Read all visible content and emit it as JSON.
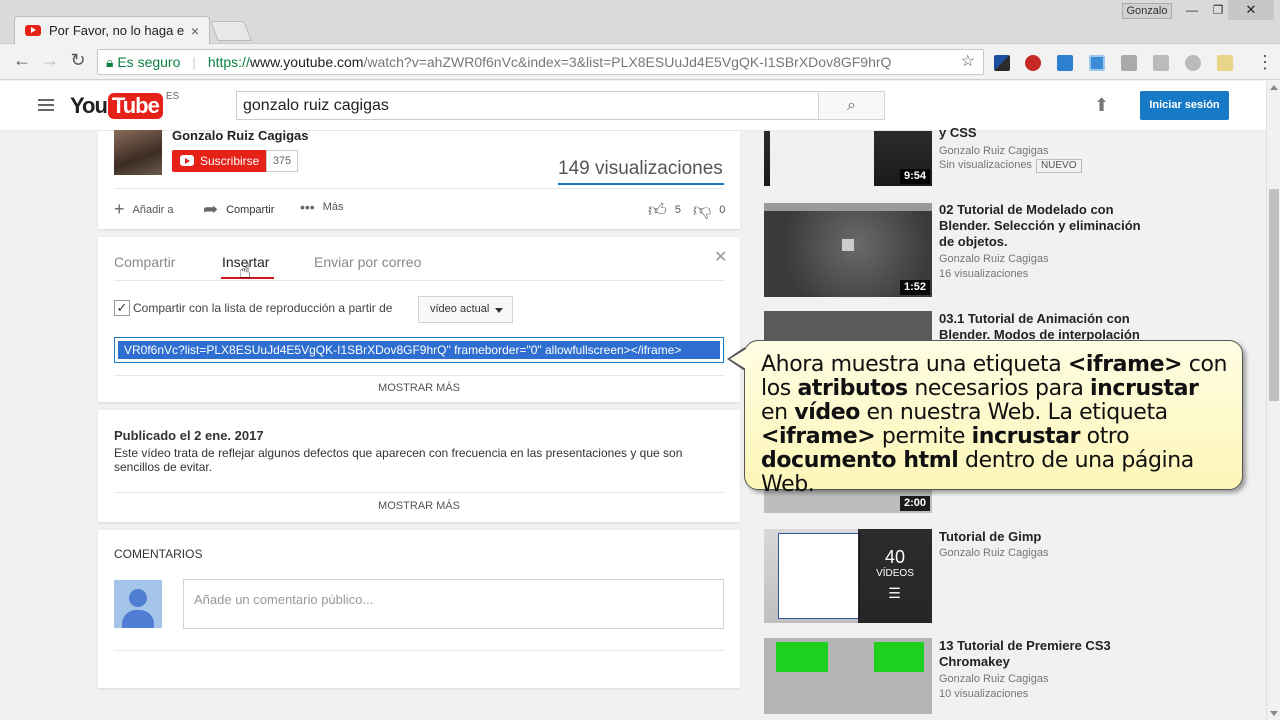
{
  "browser": {
    "tab_title": "Por Favor, no lo haga en",
    "tab_close": "×",
    "user_chip": "Gonzalo",
    "window_min": "—",
    "window_max": "❐",
    "window_close": "✕",
    "secure_label": "Es seguro",
    "url_scheme": "https://",
    "url_host": "www.youtube.com",
    "url_path": "/watch?v=ahZWR0f6nVc&index=3&list=PLX8ESUuJd4E5VgQK-I1SBrXDov8GF9hrQ"
  },
  "youtube": {
    "logo_you": "You",
    "logo_tube": "Tube",
    "logo_region": "ES",
    "search_value": "gonzalo ruiz cagigas",
    "signin_label": "Iniciar sesión"
  },
  "video": {
    "channel_name": "Gonzalo Ruiz Cagigas",
    "subscribe_label": "Suscribirse",
    "subscriber_count": "375",
    "views": "149 visualizaciones",
    "add_to_label": "Añadir a",
    "share_label": "Compartir",
    "more_label": "Más",
    "likes": "5",
    "dislikes": "0"
  },
  "share_panel": {
    "tabs": [
      "Compartir",
      "Insertar",
      "Enviar por correo"
    ],
    "active_tab": "Insertar",
    "checkbox_label": "Compartir con la lista de reproducción a partir de",
    "dropdown_value": "vídeo actual",
    "embed_code": "VR0f6nVc?list=PLX8ESUuJd4E5VgQK-I1SBrXDov8GF9hrQ\" frameborder=\"0\" allowfullscreen></iframe>",
    "show_more": "MOSTRAR MÁS"
  },
  "description": {
    "published": "Publicado el 2 ene. 2017",
    "text": "Este vídeo trata de reflejar algunos defectos que aparecen con frecuencia en las presentaciones y que son sencillos de evitar.",
    "show_more": "MOSTRAR MÁS"
  },
  "comments": {
    "title": "COMENTARIOS",
    "placeholder": "Añade un comentario público..."
  },
  "sidebar": {
    "items": [
      {
        "title": "y CSS",
        "channel": "Gonzalo Ruiz Cagigas",
        "views": "Sin visualizaciones",
        "badge": "NUEVO",
        "duration": "9:54"
      },
      {
        "title": "02 Tutorial de Modelado con Blender. Selección y eliminación de objetos.",
        "channel": "Gonzalo Ruiz Cagigas",
        "views": "16 visualizaciones",
        "duration": "1:52"
      },
      {
        "title": "03.1 Tutorial de Animación con Blender. Modos de interpolación",
        "duration": "2:00"
      },
      {
        "title": "Tutorial de Gimp",
        "channel": "Gonzalo Ruiz Cagigas",
        "playlist_count": "40",
        "playlist_label": "VÍDEOS"
      },
      {
        "title": "13 Tutorial de Premiere CS3 Chromakey",
        "channel": "Gonzalo Ruiz Cagigas",
        "views": "10 visualizaciones"
      }
    ]
  },
  "callout": {
    "p1": "Ahora muestra una etiqueta ",
    "b1": "<iframe>",
    "p2": " con los ",
    "b2": "atributos",
    "p3": " necesarios para ",
    "b3": "incrustar",
    "p4": " en ",
    "b4": "vídeo",
    "p5": " en nuestra Web. La etiqueta ",
    "b5": "<iframe>",
    "p6": " permite ",
    "b6": "incrustar",
    "p7": " otro ",
    "b7": "documento html",
    "p8": " dentro de una página Web."
  },
  "colors": {
    "youtube_red": "#e62117",
    "link_blue": "#167ac6",
    "callout_bg": "#fdf6b8"
  }
}
